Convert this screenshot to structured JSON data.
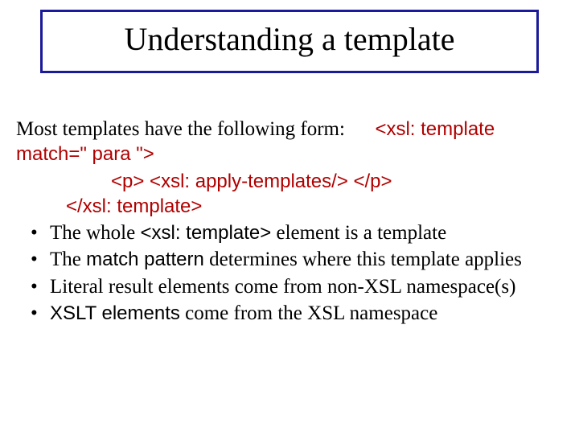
{
  "title": "Understanding a template",
  "intro_prefix": "Most templates have the following form:",
  "code_line1": "<xsl: template match=\" para \">",
  "code_line2": "<p> <xsl: apply-templates/> </p>",
  "code_line3": "</xsl: template>",
  "bullets": {
    "b1_a": "The whole ",
    "b1_code": "<xsl: template>",
    "b1_b": " element is a template",
    "b2_a": "The ",
    "b2_code": "match pattern",
    "b2_b": " determines where this template applies",
    "b3": "Literal result elements come from non-XSL namespace(s)",
    "b4_code": "XSLT elements",
    "b4_b": " come from the XSL namespace"
  }
}
